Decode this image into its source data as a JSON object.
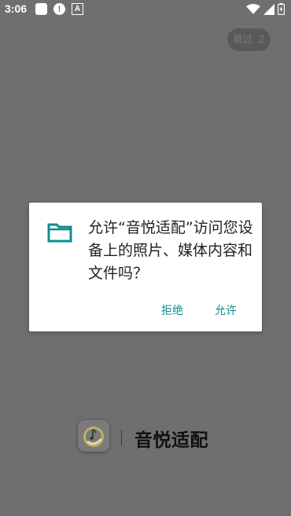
{
  "status_bar": {
    "time": "3:06",
    "alert_glyph": "!",
    "a_glyph": "A"
  },
  "skip_button": {
    "label": "跳过",
    "count": "2"
  },
  "dialog": {
    "message": "允许“音悦适配”访问您设备上的照片、媒体内容和文件吗？",
    "deny_label": "拒绝",
    "allow_label": "允许",
    "icon": "folder-icon",
    "accent_color": "#0f8c8c"
  },
  "brand": {
    "name": "音悦适配",
    "logo_icon": "music-note-logo"
  }
}
